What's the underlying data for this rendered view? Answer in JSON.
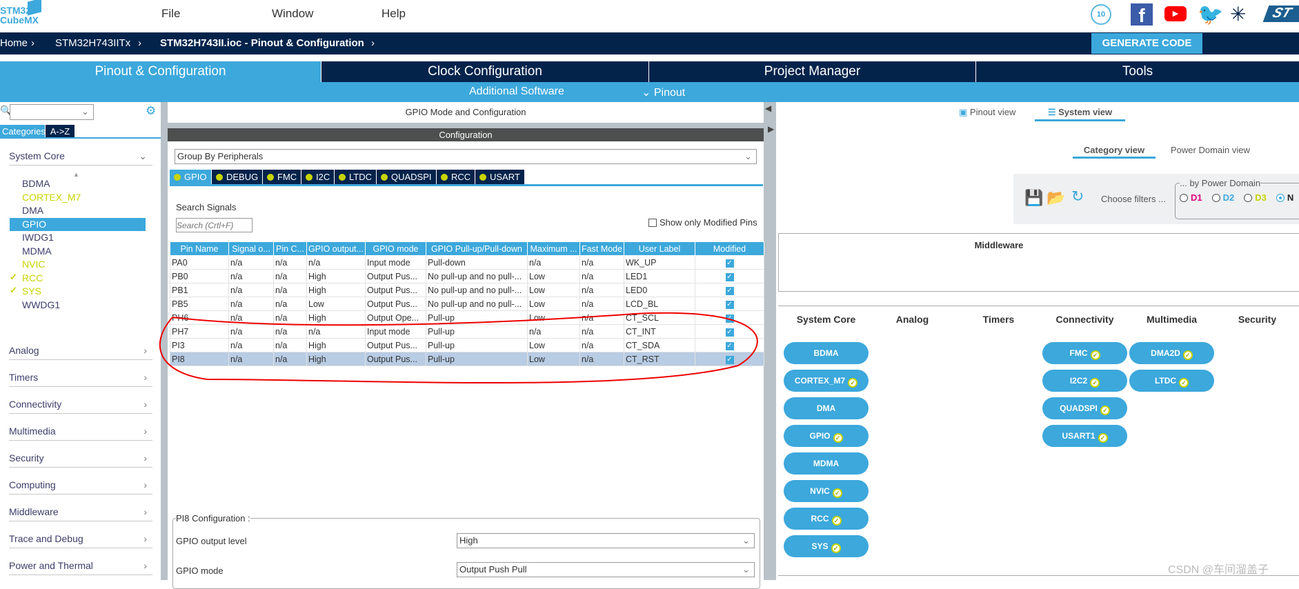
{
  "app": {
    "logo_line1": "STM32",
    "logo_line2": "CubeMX"
  },
  "menu": [
    "File",
    "Window",
    "Help"
  ],
  "breadcrumb": [
    "Home",
    "STM32H743IITx",
    "STM32H743II.ioc - Pinout & Configuration"
  ],
  "generate_label": "GENERATE CODE",
  "social_icons": [
    "anniversary-badge-icon",
    "facebook-icon",
    "youtube-icon",
    "twitter-icon",
    "network-icon",
    "st-logo-icon"
  ],
  "main_tabs": [
    "Pinout & Configuration",
    "Clock Configuration",
    "Project Manager",
    "Tools"
  ],
  "subbar": {
    "additional": "Additional Software",
    "pinout": "Pinout"
  },
  "sidebar": {
    "tabs": [
      "Categories",
      "A->Z"
    ],
    "section": "System Core",
    "items": [
      {
        "label": "BDMA",
        "color": "#3d3d6b",
        "check": false
      },
      {
        "label": "CORTEX_M7",
        "color": "#c8d400",
        "check": false
      },
      {
        "label": "DMA",
        "color": "#3d3d6b",
        "check": false
      },
      {
        "label": "GPIO",
        "color": "#ffffff",
        "check": false
      },
      {
        "label": "IWDG1",
        "color": "#3d3d6b",
        "check": false
      },
      {
        "label": "MDMA",
        "color": "#3d3d6b",
        "check": false
      },
      {
        "label": "NVIC",
        "color": "#c8d400",
        "check": false
      },
      {
        "label": "RCC",
        "color": "#c8d400",
        "check": true
      },
      {
        "label": "SYS",
        "color": "#c8d400",
        "check": true
      },
      {
        "label": "WWDG1",
        "color": "#3d3d6b",
        "check": false
      }
    ],
    "categories": [
      "Analog",
      "Timers",
      "Connectivity",
      "Multimedia",
      "Security",
      "Computing",
      "Middleware",
      "Trace and Debug",
      "Power and Thermal"
    ]
  },
  "middle": {
    "title": "GPIO Mode and Configuration",
    "config_header": "Configuration",
    "group_by": "Group By Peripherals",
    "periph_tabs": [
      "GPIO",
      "DEBUG",
      "FMC",
      "I2C",
      "LTDC",
      "QUADSPI",
      "RCC",
      "USART"
    ],
    "search_label": "Search Signals",
    "search_placeholder": "Search (Crtl+F)",
    "show_modified": "Show only Modified Pins",
    "columns": [
      "Pin Name",
      "Signal o...",
      "Pin C...",
      "GPIO output...",
      "GPIO mode",
      "GPIO Pull-up/Pull-down",
      "Maximum ...",
      "Fast Mode",
      "User Label",
      "Modified"
    ],
    "rows": [
      [
        "PA0",
        "n/a",
        "n/a",
        "n/a",
        "Input mode",
        "Pull-down",
        "n/a",
        "n/a",
        "WK_UP",
        true
      ],
      [
        "PB0",
        "n/a",
        "n/a",
        "High",
        "Output Pus...",
        "No pull-up and no pull-...",
        "Low",
        "n/a",
        "LED1",
        true
      ],
      [
        "PB1",
        "n/a",
        "n/a",
        "High",
        "Output Pus...",
        "No pull-up and no pull-...",
        "Low",
        "n/a",
        "LED0",
        true
      ],
      [
        "PB5",
        "n/a",
        "n/a",
        "Low",
        "Output Pus...",
        "No pull-up and no pull-...",
        "Low",
        "n/a",
        "LCD_BL",
        true
      ],
      [
        "PH6",
        "n/a",
        "n/a",
        "High",
        "Output Ope...",
        "Pull-up",
        "Low",
        "n/a",
        "CT_SCL",
        true
      ],
      [
        "PH7",
        "n/a",
        "n/a",
        "n/a",
        "Input mode",
        "Pull-up",
        "n/a",
        "n/a",
        "CT_INT",
        true
      ],
      [
        "PI3",
        "n/a",
        "n/a",
        "High",
        "Output Pus...",
        "Pull-up",
        "Low",
        "n/a",
        "CT_SDA",
        true
      ],
      [
        "PI8",
        "n/a",
        "n/a",
        "High",
        "Output Pus...",
        "Pull-up",
        "Low",
        "n/a",
        "CT_RST",
        true
      ]
    ],
    "selected_row": "PI8",
    "pin_config": {
      "title": "PI8 Configuration :",
      "fields": [
        {
          "label": "GPIO output level",
          "value": "High"
        },
        {
          "label": "GPIO mode",
          "value": "Output Push Pull"
        }
      ]
    }
  },
  "right": {
    "view_tabs": [
      "Pinout view",
      "System view"
    ],
    "sub_tabs": [
      "Category view",
      "Power Domain view"
    ],
    "choose_filters": "Choose filters ...",
    "power_domain_legend": "... by Power Domain",
    "domains": [
      {
        "label": "D1",
        "color": "#e0007a"
      },
      {
        "label": "D2",
        "color": "#3ca8dc"
      },
      {
        "label": "D3",
        "color": "#c8d400"
      },
      {
        "label": "N",
        "color": "#222222"
      }
    ],
    "middleware_title": "Middleware",
    "columns": [
      "System Core",
      "Analog",
      "Timers",
      "Connectivity",
      "Multimedia",
      "Security"
    ],
    "system_core": [
      {
        "label": "BDMA",
        "ok": false
      },
      {
        "label": "CORTEX_M7",
        "ok": true
      },
      {
        "label": "DMA",
        "ok": false
      },
      {
        "label": "GPIO",
        "ok": true
      },
      {
        "label": "MDMA",
        "ok": false
      },
      {
        "label": "NVIC",
        "ok": true
      },
      {
        "label": "RCC",
        "ok": true
      },
      {
        "label": "SYS",
        "ok": true
      }
    ],
    "connectivity": [
      {
        "label": "FMC",
        "ok": true
      },
      {
        "label": "I2C2",
        "ok": true
      },
      {
        "label": "QUADSPI",
        "ok": true
      },
      {
        "label": "USART1",
        "ok": true
      }
    ],
    "multimedia": [
      {
        "label": "DMA2D",
        "ok": true
      },
      {
        "label": "LTDC",
        "ok": true
      }
    ]
  },
  "watermark": "CSDN @车间溜盖子",
  "colors": {
    "navy": "#03234b",
    "accent": "#3ca8dc",
    "enabled": "#c8d400"
  }
}
